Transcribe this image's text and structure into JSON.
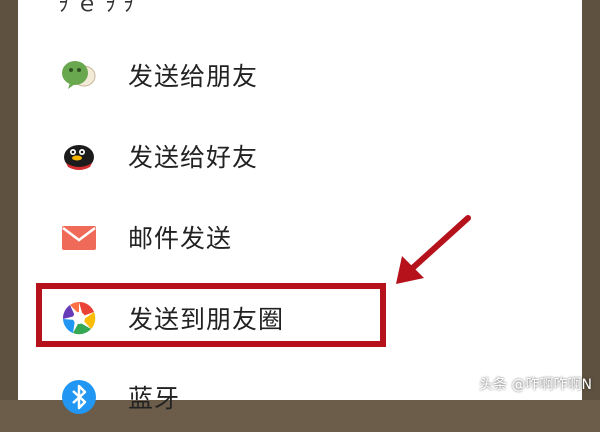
{
  "share_sheet": {
    "header_partial": "ｦ ｅ ｦ ｦ",
    "items": [
      {
        "label": "发送给朋友",
        "icon": "wechat-icon"
      },
      {
        "label": "发送给好友",
        "icon": "qq-penguin-icon"
      },
      {
        "label": "邮件发送",
        "icon": "mail-envelope-icon"
      },
      {
        "label": "发送到朋友圈",
        "icon": "moments-shutter-icon"
      },
      {
        "label": "蓝牙",
        "icon": "bluetooth-icon"
      }
    ]
  },
  "annotation": {
    "highlight_color": "#b5121b",
    "arrow_icon": "red-arrow-icon"
  },
  "watermark": "头条 @咋啊咋啊N"
}
